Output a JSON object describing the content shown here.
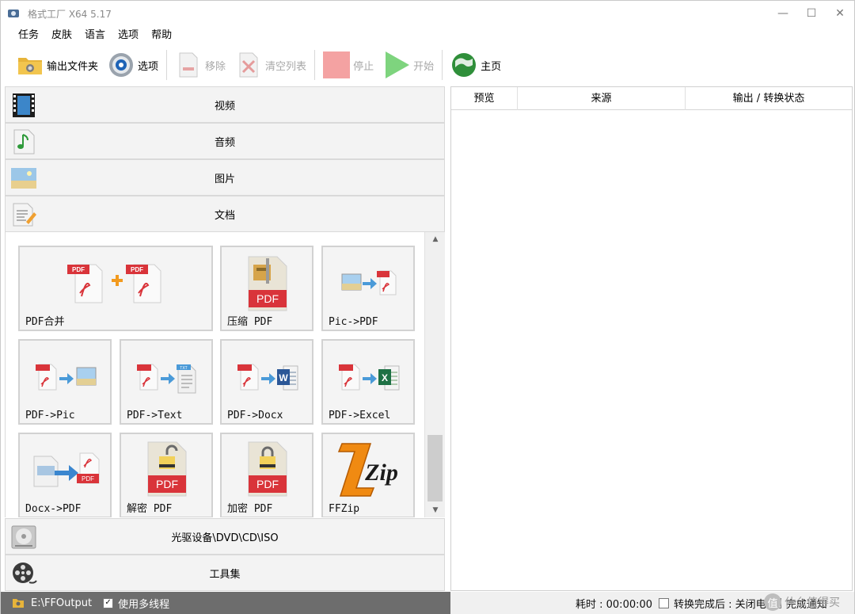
{
  "window": {
    "title": "格式工厂 X64 5.17",
    "controls": {
      "minimize": "—",
      "maximize": "☐",
      "close": "✕"
    }
  },
  "menu": [
    "任务",
    "皮肤",
    "语言",
    "选项",
    "帮助"
  ],
  "toolbar": {
    "output_folder": "输出文件夹",
    "options": "选项",
    "remove": "移除",
    "clear_list": "清空列表",
    "stop": "停止",
    "start": "开始",
    "home": "主页"
  },
  "categories": {
    "video": "视频",
    "audio": "音频",
    "image": "图片",
    "document": "文档",
    "optical": "光驱设备\\DVD\\CD\\ISO",
    "tools": "工具集"
  },
  "tiles": [
    {
      "label": "PDF合并"
    },
    {
      "label": "压缩 PDF"
    },
    {
      "label": "Pic->PDF"
    },
    {
      "label": "PDF->Pic"
    },
    {
      "label": "PDF->Text"
    },
    {
      "label": "PDF->Docx"
    },
    {
      "label": "PDF->Excel"
    },
    {
      "label": "Docx->PDF"
    },
    {
      "label": "解密 PDF"
    },
    {
      "label": "加密 PDF"
    },
    {
      "label": "FFZip"
    }
  ],
  "icon_text": {
    "pdf": "PDF",
    "txt": "TXT",
    "word": "W",
    "excel": "X",
    "zip": "Zip"
  },
  "list_columns": [
    "预览",
    "来源",
    "输出 / 转换状态"
  ],
  "status": {
    "output_path": "E:\\FFOutput",
    "multithread_label": "使用多线程",
    "multithread_checked": true,
    "elapsed_label": "耗时 : 00:00:00",
    "after_convert_label": "转换完成后 : 关闭电",
    "notify_label": "完成通知",
    "notify_checked": true
  },
  "watermark": {
    "logo": "值",
    "text": "什么值得买"
  },
  "colors": {
    "pdf_red": "#d9343a",
    "stop_red": "#f4a2a2",
    "start_green": "#7ed47e",
    "statusbar_dark": "#6d6d6d"
  }
}
